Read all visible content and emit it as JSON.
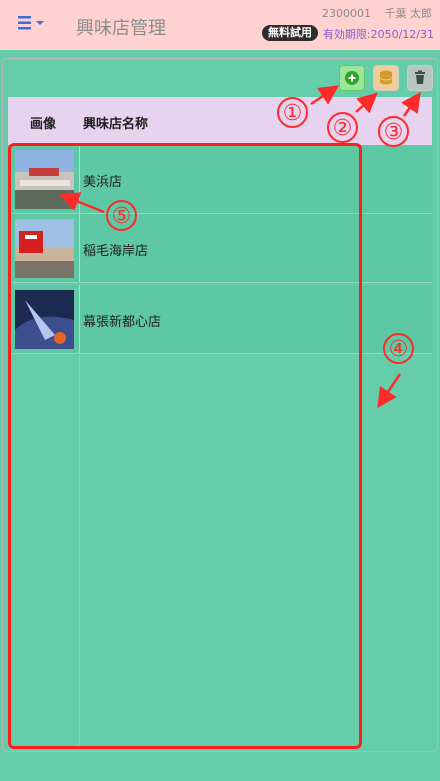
{
  "header": {
    "title": "興味店管理",
    "user_id": "2300001",
    "user_name": "千葉 太郎",
    "badge": "無料試用",
    "expiry": "有効期限:2050/12/31",
    "menu_icon": "hamburger-icon",
    "menu_color": "#3b6fd6"
  },
  "toolbar": {
    "add_icon": "plus-circle-icon",
    "db_icon": "database-icon",
    "delete_icon": "trash-icon"
  },
  "table": {
    "columns": [
      "画像",
      "興味店名称"
    ],
    "rows": [
      {
        "name": "美浜店",
        "image": "store-photo"
      },
      {
        "name": "稲毛海岸店",
        "image": "store-photo"
      },
      {
        "name": "幕張新都心店",
        "image": "store-photo"
      }
    ]
  },
  "annotations": {
    "n1": "①",
    "n2": "②",
    "n3": "③",
    "n4": "④",
    "n5": "⑤",
    "color": "#ff2a2a"
  }
}
